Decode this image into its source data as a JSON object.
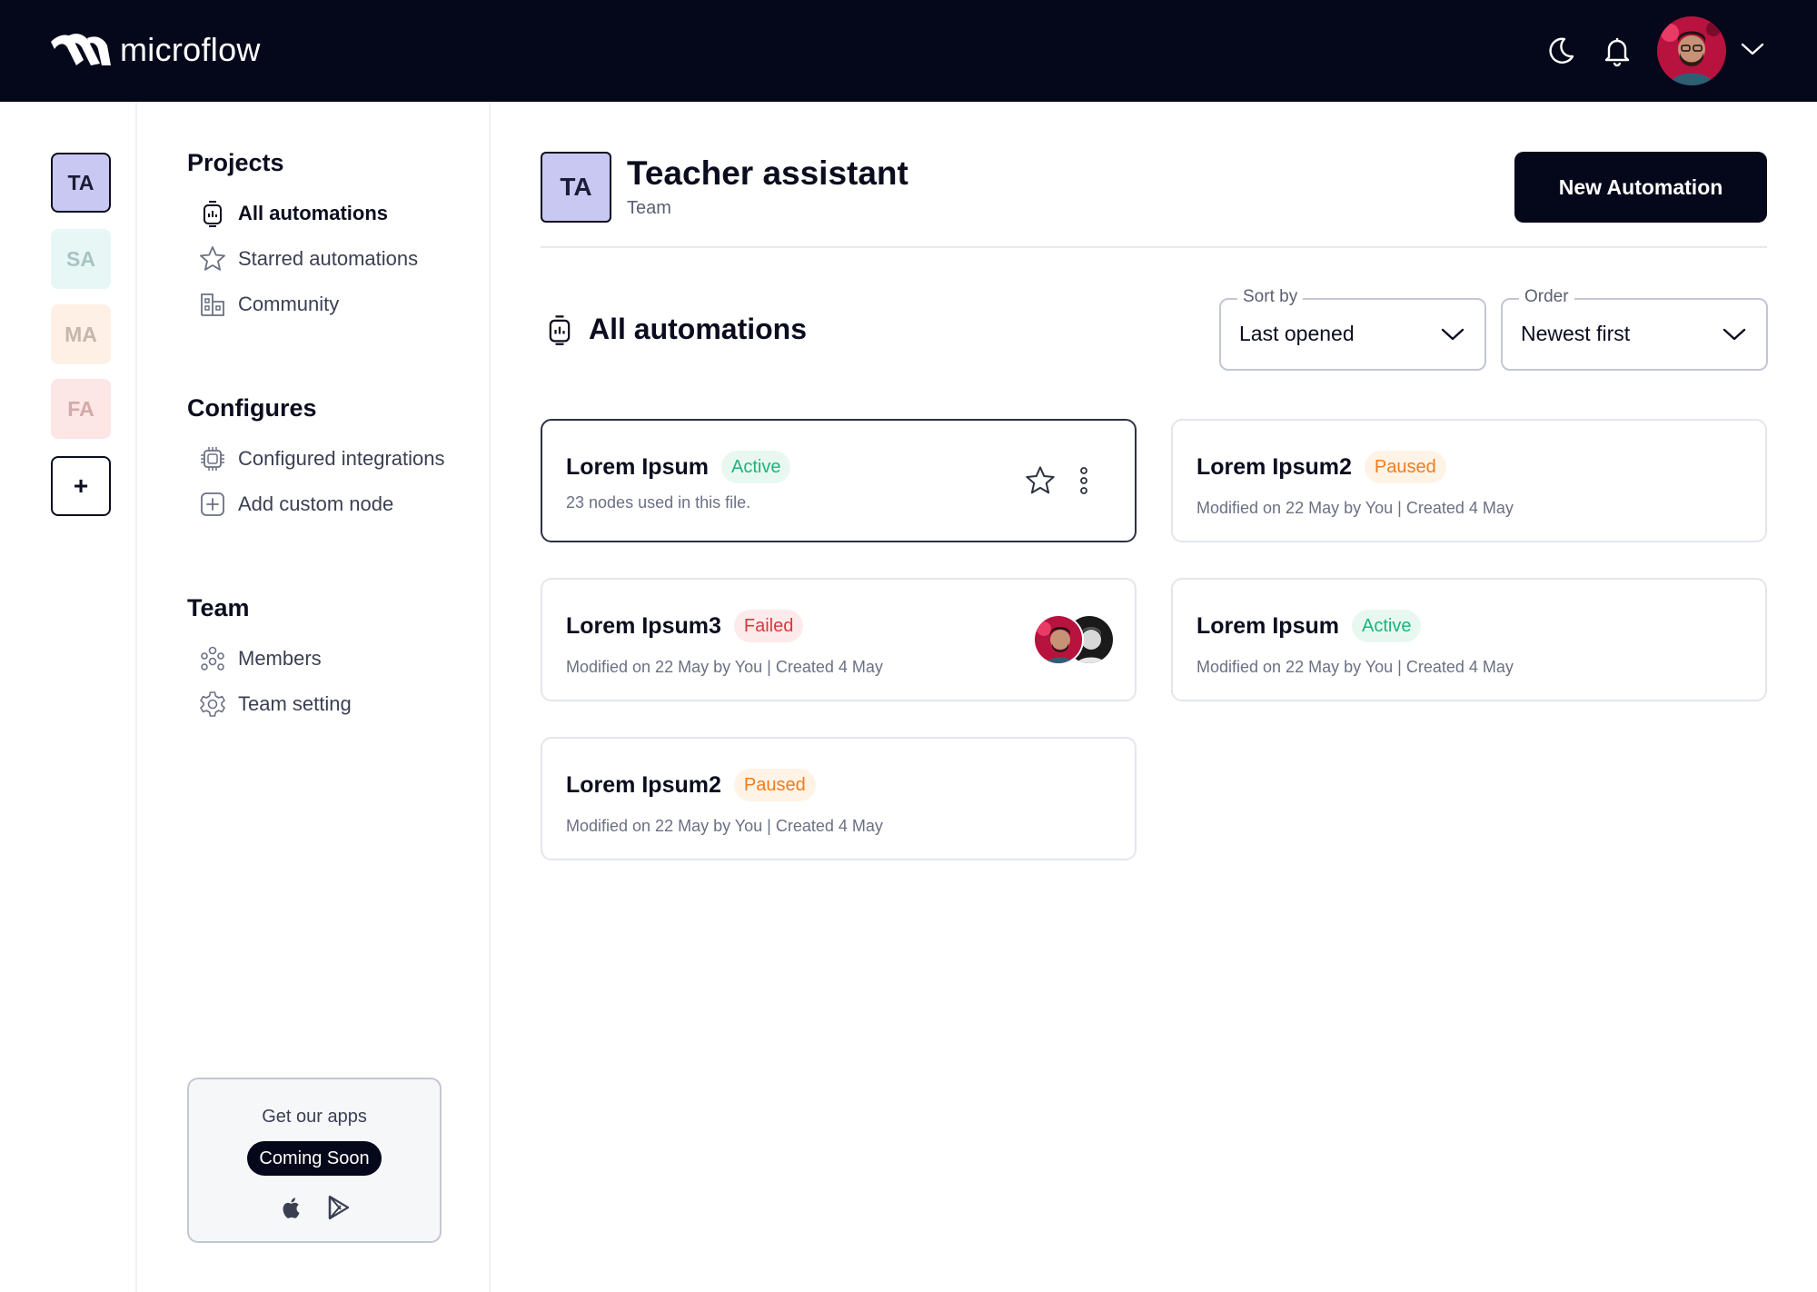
{
  "header": {
    "brand": "microflow",
    "icons": [
      "moon-icon",
      "bell-icon",
      "chevron-down-icon"
    ]
  },
  "rail": {
    "workspaces": [
      "TA",
      "SA",
      "MA",
      "FA"
    ],
    "add_label": "+"
  },
  "nav": {
    "projects": {
      "title": "Projects",
      "items": [
        {
          "label": "All automations",
          "icon": "automation-icon",
          "active": true
        },
        {
          "label": "Starred automations",
          "icon": "star-icon"
        },
        {
          "label": "Community",
          "icon": "community-icon"
        }
      ]
    },
    "configures": {
      "title": "Configures",
      "items": [
        {
          "label": "Configured integrations",
          "icon": "chip-icon"
        },
        {
          "label": "Add custom node",
          "icon": "add-square-icon"
        }
      ]
    },
    "team": {
      "title": "Team",
      "items": [
        {
          "label": "Members",
          "icon": "members-icon"
        },
        {
          "label": "Team setting",
          "icon": "settings-gear-icon"
        }
      ]
    },
    "apps": {
      "title": "Get our apps",
      "badge": "Coming Soon",
      "stores": [
        "apple-icon",
        "play-store-icon"
      ]
    }
  },
  "main": {
    "team_initials": "TA",
    "team_name": "Teacher assistant",
    "team_type": "Team",
    "new_button": "New Automation",
    "section_title": "All automations",
    "sort": {
      "label": "Sort by",
      "value": "Last opened"
    },
    "order": {
      "label": "Order",
      "value": "Newest first"
    },
    "cards": [
      {
        "name": "Lorem Ipsum",
        "status": "Active",
        "meta": "23 nodes used in this file."
      },
      {
        "name": "Lorem Ipsum2",
        "status": "Paused",
        "meta": "Modified on 22 May by You | Created 4 May"
      },
      {
        "name": "Lorem Ipsum3",
        "status": "Failed",
        "meta": "Modified on 22 May by You | Created 4 May"
      },
      {
        "name": "Lorem Ipsum",
        "status": "Active",
        "meta": "Modified on 22 May by You | Created 4 May"
      },
      {
        "name": "Lorem Ipsum2",
        "status": "Paused",
        "meta": "Modified on 22 May by You | Created 4 May"
      }
    ]
  },
  "colors": {
    "header_bg": "#05081a",
    "accent_lavender": "#c9c8f2",
    "active_green": "#1db37a",
    "paused_orange": "#f07c1e",
    "failed_red": "#d63a3a"
  }
}
